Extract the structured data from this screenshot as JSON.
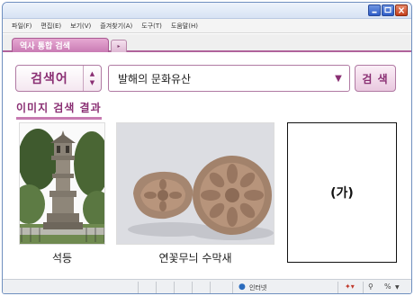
{
  "menu": [
    "파일(F)",
    "편집(E)",
    "보기(V)",
    "즐겨찾기(A)",
    "도구(T)",
    "도움말(H)"
  ],
  "tab": {
    "label": "역사 통합 검색",
    "new_tab_symbol": "▸"
  },
  "search": {
    "type_label": "검색어",
    "query": "발해의 문화유산",
    "button_label": "검 색"
  },
  "results": {
    "title": "이미지 검색 결과",
    "items": [
      {
        "caption": "석등"
      },
      {
        "caption": "연꽃무늬 수막새"
      },
      {
        "placeholder": "(가)"
      }
    ]
  },
  "status": {
    "zone": "인터넷",
    "zoom_symbol": "%"
  },
  "colors": {
    "accent": "#8a2f73",
    "tab": "#c97bb4",
    "frame": "#6f8fbf"
  }
}
